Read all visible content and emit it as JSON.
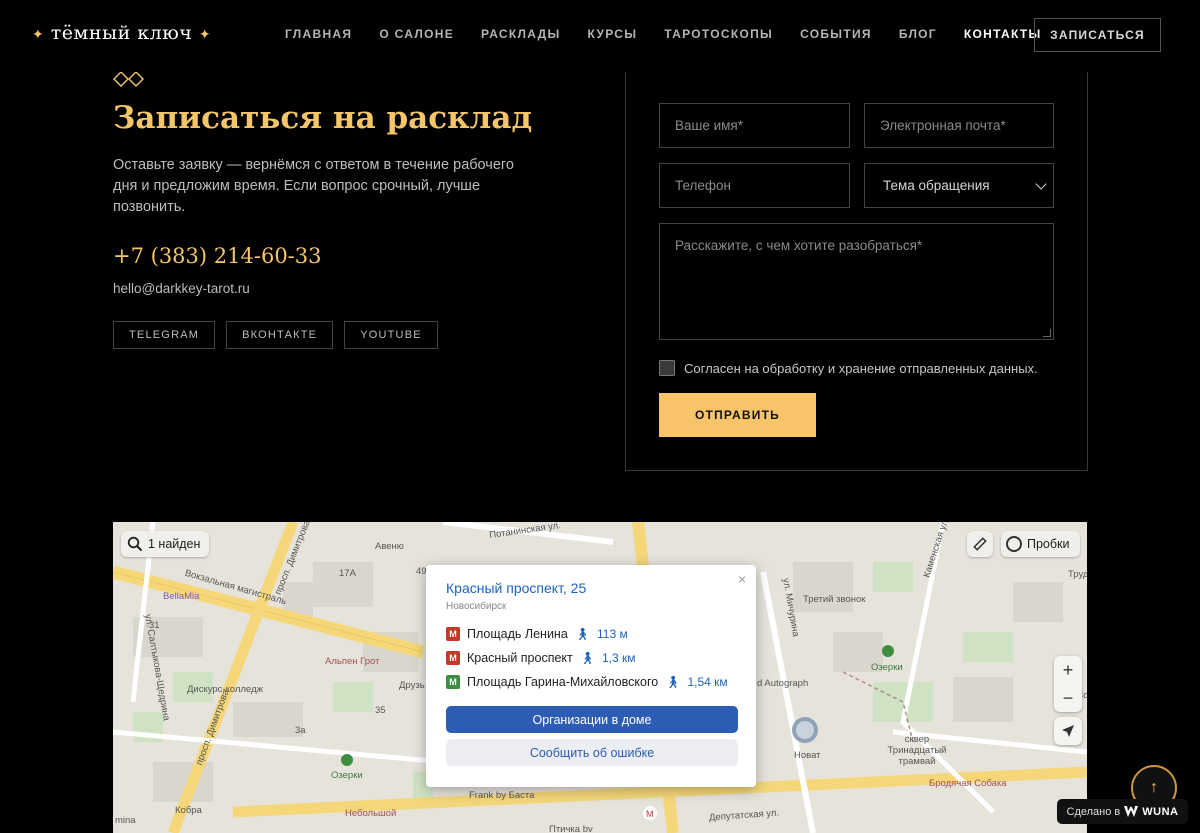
{
  "header": {
    "logo": "тёмный ключ",
    "logo_star": "✦",
    "nav": [
      "ГЛАВНАЯ",
      "О САЛОНЕ",
      "РАСКЛАДЫ",
      "КУРСЫ",
      "ТАРОТОСКОПЫ",
      "СОБЫТИЯ",
      "БЛОГ",
      "КОНТАКТЫ"
    ],
    "active_nav": "КОНТАКТЫ",
    "book_button": "ЗАПИСАТЬСЯ"
  },
  "contact": {
    "title": "Записаться на расклад",
    "lead": "Оставьте заявку — вернёмся с ответом в течение рабочего дня и предложим время. Если вопрос срочный, лучше позвонить.",
    "phone": "+7 (383) 214-60-33",
    "email": "hello@darkkey-tarot.ru",
    "socials": [
      "TELEGRAM",
      "ВКОНТАКТЕ",
      "YOUTUBE"
    ]
  },
  "form": {
    "name_placeholder": "Ваше имя*",
    "email_placeholder": "Электронная почта*",
    "phone_placeholder": "Телефон",
    "topic_value": "Тема обращения",
    "message_placeholder": "Расскажите, с чем хотите разобраться*",
    "consent_label": "Согласен на обработку и хранение отправленных данных.",
    "consent_checked": false,
    "submit_label": "ОТПРАВИТЬ"
  },
  "map": {
    "found_label": "1 найден",
    "traffic_label": "Пробки",
    "zoom_in": "+",
    "zoom_out": "−",
    "balloon": {
      "address": "Красный проспект, 25",
      "city": "Новосибирск",
      "close": "×",
      "metro": [
        {
          "icon": "М",
          "name": "Площадь Ленина",
          "distance": "113 м",
          "color": "#c0392b"
        },
        {
          "icon": "М",
          "name": "Красный проспект",
          "distance": "1,3 км",
          "color": "#c0392b"
        },
        {
          "icon": "М",
          "name": "Площадь Гарина-Михайловского",
          "distance": "1,54 км",
          "color": "#3e8e41"
        }
      ],
      "org_button": "Организации в доме",
      "error_button": "Сообщить об ошибке"
    },
    "labels": {
      "potaninskaya": "Потанинская ул.",
      "avenue": "Авеню",
      "vokzalnaya": "Вокзальная магистраль",
      "dimitrova": "просп. Димитрова",
      "dimitrova2": "просп. Димитрова",
      "saltykova": "ул. Салтыкова-Щедрина",
      "bellamia": "BellaMia",
      "alpen": "Альпен Грот",
      "druz": "Друзь",
      "diskurs": "Дискурс-колледж",
      "ozerki": "Озерки",
      "ozerki2": "Озерки",
      "kobra": "Кобра",
      "frank": "Frank by Баста",
      "nebolshoy": "Небольшой",
      "ptichka": "Птичка bv",
      "mina": "mina",
      "deputatskaya": "Депутатская ул.",
      "michurina": "ул. Мичурина",
      "tretiy": "Третий звонок",
      "autograph": "d Autograph",
      "novat": "Новат",
      "skver": "сквер Тринадцатый трамвай",
      "brodyachaya": "Бродячая Собака",
      "kamenskaya": "Каменская ул.",
      "trud": "Труд",
      "ul_sov": "ул. Сов",
      "n17a": "17А",
      "n49": "49",
      "n3a": "3а",
      "n31": "31",
      "n35": "35"
    }
  },
  "totop_arrow": "↑",
  "made_by": {
    "prefix": "Сделано в",
    "brand": "WUNA"
  },
  "colors": {
    "accent": "#f5c56a",
    "button": "#f8c46a",
    "background": "#000000",
    "metro_red": "#c0392b",
    "metro_green": "#3e8e41",
    "map_link": "#1f62b8"
  }
}
